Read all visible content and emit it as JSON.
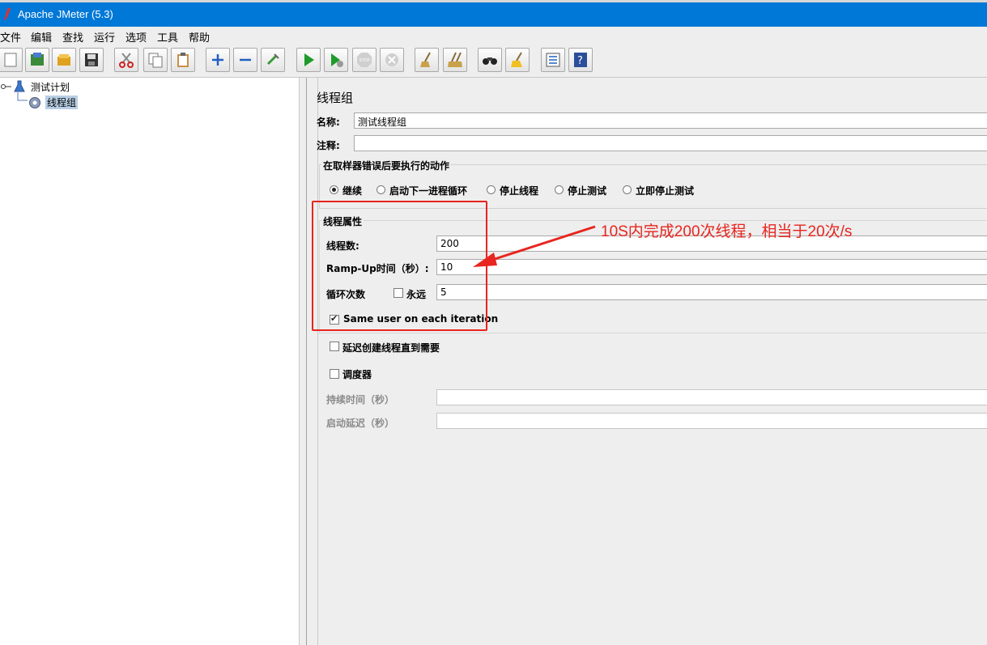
{
  "window": {
    "title": "Apache JMeter (5.3)"
  },
  "menu": [
    "文件",
    "编辑",
    "查找",
    "运行",
    "选项",
    "工具",
    "帮助"
  ],
  "toolbar": [
    {
      "name": "new-icon"
    },
    {
      "name": "templates-icon"
    },
    {
      "name": "open-icon"
    },
    {
      "name": "save-icon"
    },
    {
      "name": "cut-icon"
    },
    {
      "name": "copy-icon"
    },
    {
      "name": "paste-icon"
    },
    {
      "name": "expand-icon"
    },
    {
      "name": "collapse-icon"
    },
    {
      "name": "toggle-icon"
    },
    {
      "name": "start-icon"
    },
    {
      "name": "start-no-pause-icon"
    },
    {
      "name": "stop-icon"
    },
    {
      "name": "shutdown-icon"
    },
    {
      "name": "clear-icon"
    },
    {
      "name": "clear-all-icon"
    },
    {
      "name": "search-icon"
    },
    {
      "name": "reset-search-icon"
    },
    {
      "name": "function-helper-icon"
    },
    {
      "name": "help-icon"
    }
  ],
  "tree": {
    "root": "测试计划",
    "child": "线程组"
  },
  "panel": {
    "title": "线程组",
    "name_label": "名称:",
    "name_value": "测试线程组",
    "comment_label": "注释:",
    "comment_value": "",
    "error_action": {
      "legend": "在取样器错误后要执行的动作",
      "options": [
        "继续",
        "启动下一进程循环",
        "停止线程",
        "停止测试",
        "立即停止测试"
      ],
      "selected": "继续"
    },
    "thread_props": {
      "legend": "线程属性",
      "threads_label": "线程数:",
      "threads_value": "200",
      "rampup_label": "Ramp-Up时间（秒）:",
      "rampup_value": "10",
      "loop_label": "循环次数",
      "forever_label": "永远",
      "loop_value": "5",
      "same_user_label": "Same user on each iteration"
    },
    "delay_label": "延迟创建线程直到需要",
    "scheduler_label": "调度器",
    "duration_label": "持续时间（秒）",
    "startup_delay_label": "启动延迟（秒）",
    "duration_value": "",
    "startup_delay_value": ""
  },
  "annotation": "10S内完成200次线程，相当于20次/s",
  "colors": {
    "titlebar": "#0078d7",
    "annotation": "#e8251f"
  }
}
